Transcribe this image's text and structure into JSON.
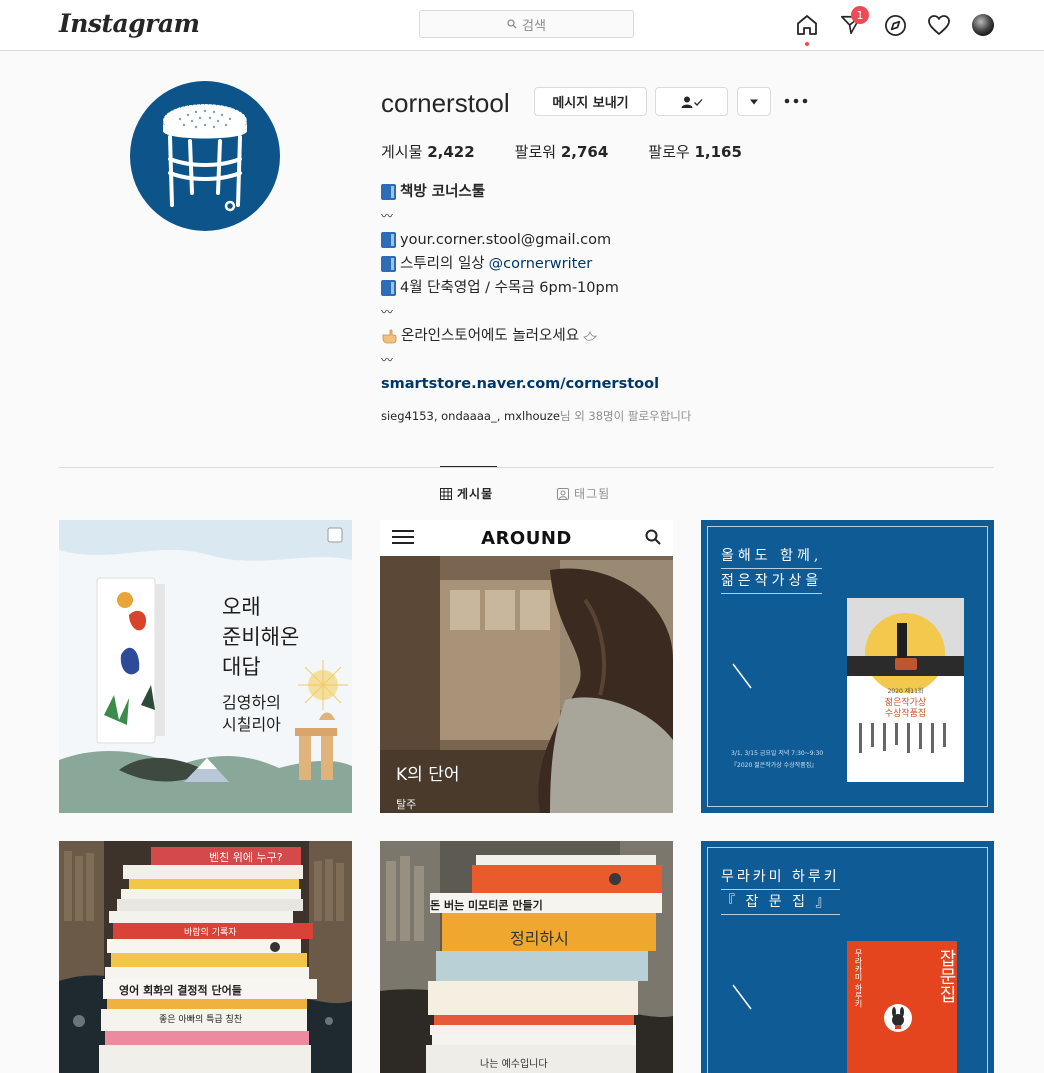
{
  "app": {
    "logo": "Instagram"
  },
  "nav": {
    "search_placeholder": "검색",
    "notification_count": "1"
  },
  "profile": {
    "username": "cornerstool",
    "message_button": "메시지 보내기",
    "stats": [
      {
        "label": "게시물",
        "value": "2,422"
      },
      {
        "label": "팔로워",
        "value": "2,764"
      },
      {
        "label": "팔로우",
        "value": "1,165"
      }
    ],
    "bio": {
      "name": "책방 코너스툴",
      "wave": "〰",
      "email": "your.corner.stool@gmail.com",
      "daily_prefix": "스투리의 일상",
      "daily_mention": "@cornerwriter",
      "hours": "4월 단축영업 / 수목금 6pm-10pm",
      "store_note": "온라인스토어에도 놀러오세요",
      "link": "smartstore.naver.com/cornerstool"
    },
    "followed_by_names": "sieg4153, ondaaaa_, mxlhouze",
    "followed_by_suffix": "님 외 38명이 팔로우합니다"
  },
  "tabs": [
    {
      "label": "게시물"
    },
    {
      "label": "태그됨"
    }
  ],
  "posts": {
    "p1": {
      "title_lines": "오래\n준비해온\n대답",
      "subtitle": "김영하의\n시칠리아"
    },
    "p2": {
      "header": "AROUND",
      "caption": "K의 단어",
      "small": "탈주"
    },
    "p3": {
      "title_line1": "올해도 함께,",
      "title_line2": "젊은작가상을",
      "book_line1": "2020 제11회",
      "book_line2": "젊은작가상",
      "book_line3": "수상작품집",
      "footer_line1": "3/1, 3/15 금요일 저녁 7:30~9:30",
      "footer_line2": "『2020 젊은작가상 수상작품집』"
    },
    "p4": {
      "book1": "벤친 위에 누구?",
      "book2": "바람의 기록자",
      "book3": "영어 회화의 결정적 단어들",
      "book4": "좋은 아빠의 특급 칭찬"
    },
    "p5": {
      "book1": "돈 버는 미모티콘 만들기",
      "book2": "정리하시",
      "book3": "나는 예수입니다"
    },
    "p6": {
      "title_line1": "무라카미 하루키",
      "title_line2": "『 잡 문 집 』",
      "book_title": "잡문집",
      "book_author": "무라카미 하루키"
    }
  },
  "colors": {
    "brand_blue": "#0c5489",
    "badge_red": "#ed4956",
    "link": "#00376b"
  }
}
